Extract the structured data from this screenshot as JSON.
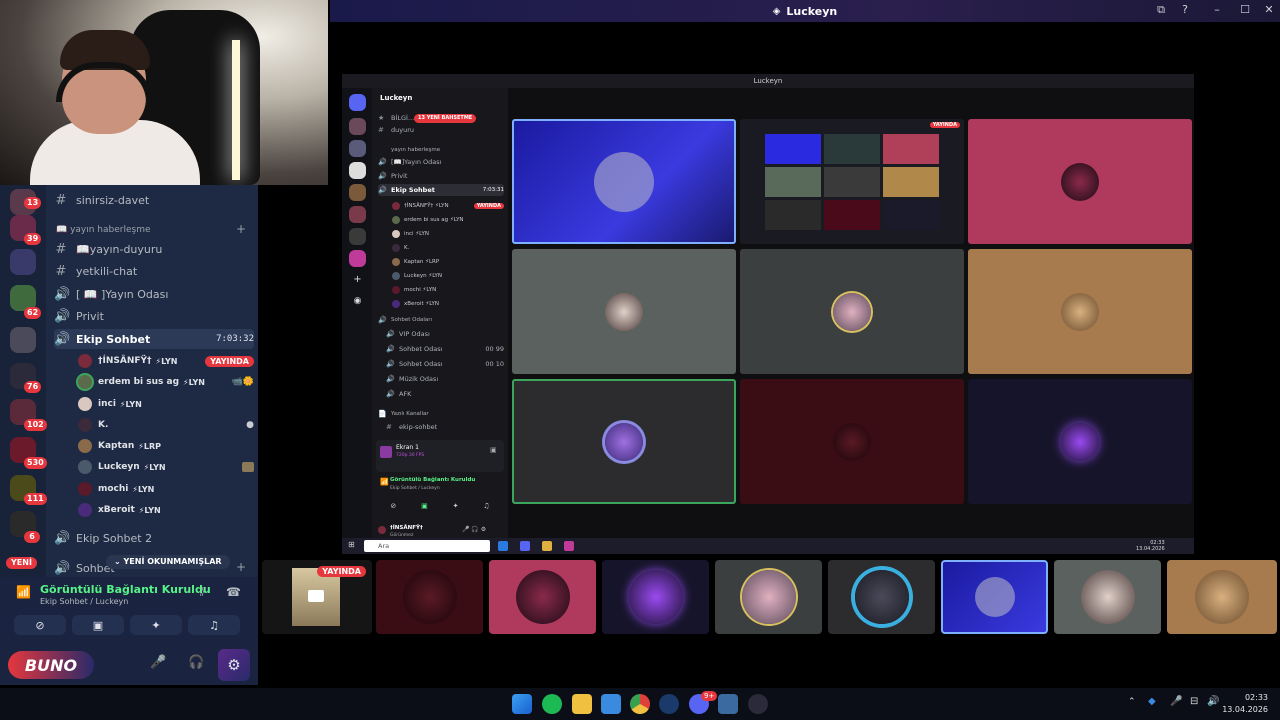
{
  "window": {
    "title": "Luckeyn"
  },
  "left_sidebar": {
    "server_badges": [
      "13",
      "39",
      "62",
      "76",
      "102",
      "530",
      "111",
      "6"
    ],
    "new_badge": "YENİ",
    "channels": [
      {
        "icon": "#",
        "label": "sinirsiz-davet"
      },
      {
        "icon": "#",
        "label": "📖yayın-duyuru"
      },
      {
        "icon": "#",
        "label": "yetkili-chat"
      },
      {
        "icon": "🔊",
        "label": "[ 📖 ]Yayın Odası"
      },
      {
        "icon": "🔊",
        "label": "Privit"
      }
    ],
    "category_yayin": "📖 yayın haberleşme",
    "active_voice": {
      "label": "Ekip Sohbet",
      "timer": "7:03:32"
    },
    "voice_users": [
      {
        "name": "†ÍNSÂNFŸ†",
        "tag": "⚡LYN",
        "badge": "YAYINDA"
      },
      {
        "name": "erdem bi sus ag",
        "tag": "⚡LYN",
        "badge": ""
      },
      {
        "name": "inci",
        "tag": "⚡LYN",
        "badge": ""
      },
      {
        "name": "K.",
        "tag": "",
        "badge": ""
      },
      {
        "name": "Kaptan",
        "tag": "⚡LRP",
        "badge": ""
      },
      {
        "name": "Luckeyn",
        "tag": "⚡LYN",
        "badge": ""
      },
      {
        "name": "mochi",
        "tag": "⚡LYN",
        "badge": ""
      },
      {
        "name": "xBeroit",
        "tag": "⚡LYN",
        "badge": ""
      }
    ],
    "ekip_sohbet_2": "Ekip Sohbet 2",
    "sohbet_partial": "Sohbet",
    "unread_pill": "YENİ OKUNMAMIŞLAR",
    "voice_panel": {
      "status": "Görüntülü Bağlantı Kuruldu",
      "location": "Ekip Sohbet / Luckeyn"
    },
    "user_logo": "BUNO"
  },
  "share": {
    "title": "Luckeyn",
    "server_name": "Luckeyn",
    "new_topics_pill": "13 YENİ BAHSETME",
    "rows": [
      {
        "icon": "★",
        "label": "BİLGİ..."
      },
      {
        "icon": "#",
        "label": "duyuru"
      },
      {
        "icon": "",
        "label": "yayın haberleşme"
      },
      {
        "icon": "🔊",
        "label": "[📖]Yayın Odası"
      },
      {
        "icon": "🔊",
        "label": "Privit"
      }
    ],
    "active": {
      "label": "Ekip Sohbet",
      "timer": "7:03:31"
    },
    "users": [
      {
        "name": "†ÍNSÂNFŸ† ⚡LYN",
        "badge": "YAYINDA"
      },
      {
        "name": "erdem bi sus ag ⚡LYN",
        "badge": ""
      },
      {
        "name": "inci ⚡LYN",
        "badge": ""
      },
      {
        "name": "K.",
        "badge": ""
      },
      {
        "name": "Kaptan ⚡LRP",
        "badge": ""
      },
      {
        "name": "Luckeyn ⚡LYN",
        "badge": ""
      },
      {
        "name": "mochi ⚡LYN",
        "badge": ""
      },
      {
        "name": "xBeroit ⚡LYN",
        "badge": ""
      }
    ],
    "cat_sohbet": "Sohbet Odaları",
    "rooms": [
      {
        "label": "VIP Odası",
        "count": ""
      },
      {
        "label": "Sohbet Odası",
        "count": "00 99"
      },
      {
        "label": "Sohbet Odası",
        "count": "00 10"
      },
      {
        "label": "Müzik Odası",
        "count": ""
      },
      {
        "label": "AFK",
        "count": ""
      }
    ],
    "cat_yazili": "Yazılı Kanallar",
    "yazili_partial": "ekip-sohbet",
    "screen_panel": {
      "title": "Ekran 1",
      "sub": "720p 30 FPS"
    },
    "voice_status": "Görüntülü Bağlantı Kuruldu",
    "voice_location": "Ekip Sohbet / Luckeyn",
    "user_name": "†ÍNSÂNFŸ†",
    "user_status": "Görünmez",
    "live_badge": "YAYINDA",
    "search_placeholder": "Ara",
    "clock": {
      "time": "02:33",
      "date": "13.04.2026"
    }
  },
  "bottom_strip": {
    "live_badge": "YAYINDA"
  },
  "taskbar": {
    "time": "02:33",
    "date": "13.04.2026",
    "discord_badge": "9+"
  },
  "colors": {
    "accent_live": "#e5373d",
    "sidebar_bg": "#1e2a44",
    "active_green": "#57f287",
    "speaking_ring": "#3ba55c"
  }
}
